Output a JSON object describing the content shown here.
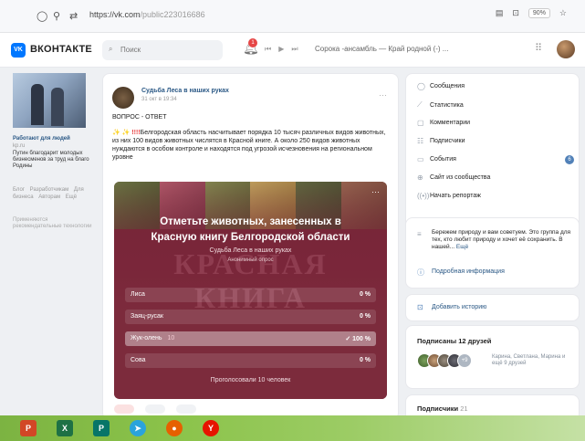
{
  "browser": {
    "url_host": "https://vk.com",
    "url_path": "/public223016686",
    "zoom": "90%"
  },
  "header": {
    "logo_text": "VK",
    "site_name": "ВКОНТАКТЕ",
    "search_placeholder": "Поиск",
    "notifications_count": "1",
    "now_playing": "Сорока -ансамбль — Край родной (-) ..."
  },
  "left": {
    "ad_title": "Работают для людей",
    "ad_domain": "kp.ru",
    "ad_text": "Путин благодарит молодых бизнесменов за труд на благо Родины",
    "links": [
      "Блог",
      "Разработчикам",
      "Для бизнеса",
      "Авторам",
      "Ещё"
    ],
    "footer": "Применяются рекомендательные технологии"
  },
  "post": {
    "author": "Судьба Леса в наших руках",
    "date": "31 окт в 19:34",
    "heading": "ВОПРОС - ОТВЕТ",
    "emoji": "✨ ✨",
    "marks": "!!!!",
    "text": "Белгородская область насчитывает порядка 10 тысяч различных видов животных, из них 100 видов животных числятся в Красной книге. А около 250 видов животных нуждаются в особом контроле и находятся под угрозой исчезновения на региональном уровне"
  },
  "poll": {
    "title_line1": "Отметьте животных, занесенных в",
    "title_line2": "Красную книгу Белгородской области",
    "author": "Судьба Леса в наших руках",
    "type": "Анонимный опрос",
    "watermark": "КРАСНАЯ КНИГА",
    "options": [
      {
        "label": "Лиса",
        "count": "",
        "pct": "0 %",
        "share": 0
      },
      {
        "label": "Заяц-русак",
        "count": "",
        "pct": "0 %",
        "share": 0
      },
      {
        "label": "Жук-олень",
        "count": "10",
        "pct": "✓ 100 %",
        "share": 1
      },
      {
        "label": "Сова",
        "count": "",
        "pct": "0 %",
        "share": 0
      }
    ],
    "footer": "Проголосовали 10 человек"
  },
  "menu": {
    "items": [
      {
        "label": "Сообщения",
        "icon": "message-icon"
      },
      {
        "label": "Статистика",
        "icon": "stats-icon"
      },
      {
        "label": "Комментарии",
        "icon": "comment-icon"
      },
      {
        "label": "Подписчики",
        "icon": "subscribers-icon"
      },
      {
        "label": "События",
        "icon": "events-icon",
        "badge": "6"
      },
      {
        "label": "Сайт из сообщества",
        "icon": "globe-icon"
      },
      {
        "label": "Начать репортаж",
        "icon": "broadcast-icon"
      }
    ]
  },
  "info": {
    "text": "Бережем природу и вам советуем. Это группа для тех, кто любит природу и хочет её сохранить. В нашей...",
    "more": "Ещё",
    "link": "Подробная информация"
  },
  "history": {
    "link": "Добавить историю"
  },
  "friends": {
    "title": "Подписаны 12 друзей",
    "plus": "+9",
    "names": "Карина, Светлана, Марина и ещё 9 друзей"
  },
  "subscribers": {
    "title": "Подписчики",
    "count": "21"
  },
  "taskbar": {
    "apps": [
      {
        "icon": "powerpoint-icon",
        "glyph": "P",
        "color": "#d24726"
      },
      {
        "icon": "excel-icon",
        "glyph": "X",
        "color": "#1e7145"
      },
      {
        "icon": "publisher-icon",
        "glyph": "P",
        "color": "#077568"
      },
      {
        "icon": "telegram-icon",
        "glyph": "➤",
        "color": "#2aa3dc"
      },
      {
        "icon": "firefox-icon",
        "glyph": "●",
        "color": "#e66000"
      },
      {
        "icon": "yandex-browser-icon",
        "glyph": "Y",
        "color": "#e61400"
      }
    ]
  }
}
